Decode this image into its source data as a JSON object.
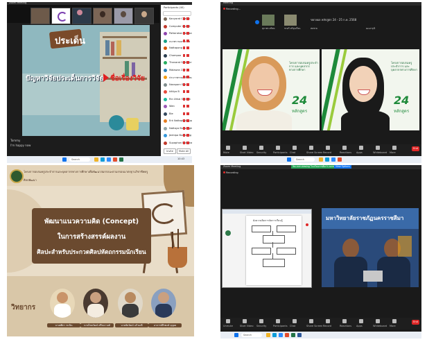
{
  "panel1": {
    "app": "Zoom Meeting",
    "slide_heading": "ประเด็น",
    "slide_left": "ปัญหาวิจัยประเด็นการวิจัย",
    "slide_right": "ชื่อเรื่องวิจัย",
    "chat_sender": "Tommy",
    "chat_message": "I'm happy now",
    "participants_title": "Participants (40)",
    "invite_label": "Invite",
    "mute_all_label": "Mute All",
    "participants": [
      "Kanyarat Chaiyo",
      "Computer Lazzyt",
      "Pattarakan Somsak",
      "ธนาพร ทองกระจ่าง",
      "Nattapong",
      "Chompoo",
      "Thanarat Samranrat",
      "Malawan 222",
      "ประภาพรรณ ศรีเกษม ฯลฯ",
      "Naraporn Suk",
      "kittiya B",
      "Rin Uthai Sittisuk",
      "Wan",
      "Bie",
      "Erk Nattaphat Suputpong",
      "Nattaya Buasengk",
      "Jednipa Bunruang",
      "Supaphon Rattanachai"
    ]
  },
  "panel2": {
    "app": "Meeting",
    "recording": "Recording...",
    "header_text": "ขยายผล หลักสูตร  24 - 25 ก.ค. 2568",
    "thumbs": [
      "สุภาพร ศรีสด",
      "ชาตรี ศรีอุ่นเรือน",
      "สมชาย",
      "ผอ.ดารุณี"
    ],
    "banner_text": "โครงการอบรมครูประจำการ และบุคลากรทางการศึกษา",
    "course_number": "24",
    "course_label": "หลักสูตร",
    "toolbar": [
      "Mute",
      "Start Video",
      "Security",
      "Participants",
      "Chat",
      "Share Screen",
      "Record",
      "Reactions",
      "Apps",
      "Whiteboard",
      "More"
    ],
    "end": "End"
  },
  "panel3": {
    "header": "โครงการอบรมครูประจำการและบุคลากรทางการศึกษาเพื่อพัฒนาสมรรถนะตามกรอบมาตรฐานวิชาชีพครู",
    "org": "ศิลปพัฒนา",
    "title_line1": "พัฒนาแนวความคิด (Concept)",
    "title_line2": "ในการสร้างสรรค์ผลงาน",
    "title_line3": "ศิลปะสำหรับประกวดศิลปหัตถกรรมนักเรียน",
    "speakers_label": "วิทยากร",
    "speakers": [
      "นางศศิภา ชะนิน",
      "นายไชยวัฒน์ ศรีธนาวงศ์",
      "นายชัยวัฒน์ แก้วมณี",
      "อาจารย์ธีรพงษ์ บุญยง"
    ]
  },
  "panel4": {
    "app": "Zoom Meeting",
    "status": "You are viewing โรงเรียนราชสีมา's screen",
    "view_options": "View Options",
    "recording": "Recording",
    "university": "มหาวิทยาลัยราชภัฏนครราชสีมา",
    "doc_title": "ผังความคิดการจัดการเรียนรู้",
    "toolbar": [
      "Unmute",
      "Start Video",
      "Security",
      "Participants",
      "Chat",
      "Share Screen",
      "Record",
      "Reactions",
      "Apps",
      "Whiteboard",
      "More"
    ],
    "end": "End"
  },
  "taskbar": {
    "search": "Search",
    "time": "10:43"
  },
  "colors": {
    "zoom_green": "#23a455",
    "zoom_blue": "#0e72ed",
    "end_red": "#e02828",
    "slide_teal": "#8fb8bf",
    "banner_green": "#1e8a3a",
    "brown": "#6b4a2f"
  }
}
